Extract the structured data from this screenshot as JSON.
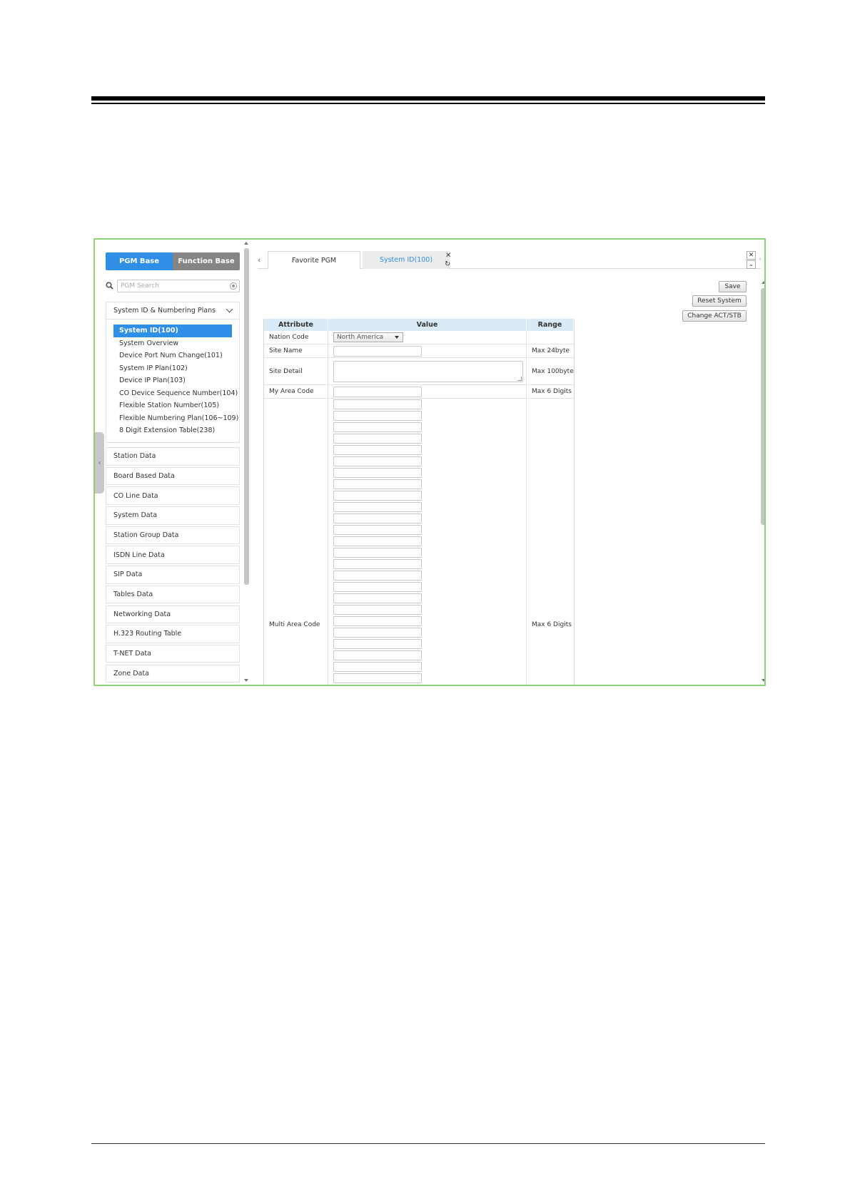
{
  "sidebar": {
    "mode_tabs": {
      "pgm_base": "PGM Base",
      "function_base": "Function Base"
    },
    "search": {
      "placeholder": "PGM Search",
      "value": ""
    },
    "open_group": {
      "label": "System ID & Numbering Plans",
      "items": [
        {
          "label": "System ID(100)",
          "active": true
        },
        {
          "label": "System Overview"
        },
        {
          "label": "Device Port Num Change(101)"
        },
        {
          "label": "System IP Plan(102)"
        },
        {
          "label": "Device IP Plan(103)"
        },
        {
          "label": "CO Device Sequence Number(104)"
        },
        {
          "label": "Flexible Station Number(105)"
        },
        {
          "label": "Flexible Numbering Plan(106~109)"
        },
        {
          "label": "8 Digit Extension Table(238)"
        }
      ]
    },
    "groups": [
      "Station Data",
      "Board Based Data",
      "CO Line Data",
      "System Data",
      "Station Group Data",
      "ISDN Line Data",
      "SIP Data",
      "Tables Data",
      "Networking Data",
      "H.323 Routing Table",
      "T-NET Data",
      "Zone Data"
    ]
  },
  "tabs": {
    "items": [
      "Favorite PGM",
      "System ID(100)"
    ],
    "active_index": 1
  },
  "actions": {
    "save": "Save",
    "reset_system": "Reset System",
    "change_act_stb": "Change ACT/STB"
  },
  "table": {
    "headers": {
      "attribute": "Attribute",
      "value": "Value",
      "range": "Range"
    },
    "rows": {
      "nation_code": {
        "label": "Nation Code",
        "value": "North America",
        "range": ""
      },
      "site_name": {
        "label": "Site Name",
        "value": "",
        "range": "Max 24byte"
      },
      "site_detail": {
        "label": "Site Detail",
        "value": "",
        "range": "Max 100byte"
      },
      "my_area_code": {
        "label": "My Area Code",
        "value": "",
        "range": "Max 6 Digits"
      },
      "multi_area_code": {
        "label": "Multi Area Code",
        "values": [
          "",
          "",
          "",
          "",
          "",
          "",
          "",
          "",
          "",
          "",
          "",
          "",
          "",
          "",
          "",
          "",
          "",
          "",
          "",
          "",
          "",
          "",
          "",
          "",
          "",
          ""
        ],
        "range": "Max 6 Digits"
      }
    }
  },
  "colors": {
    "accent": "#2f8fe6",
    "inactive_tab": "#858585",
    "frame_border": "#8fd07a",
    "table_header": "#daeaf6"
  }
}
